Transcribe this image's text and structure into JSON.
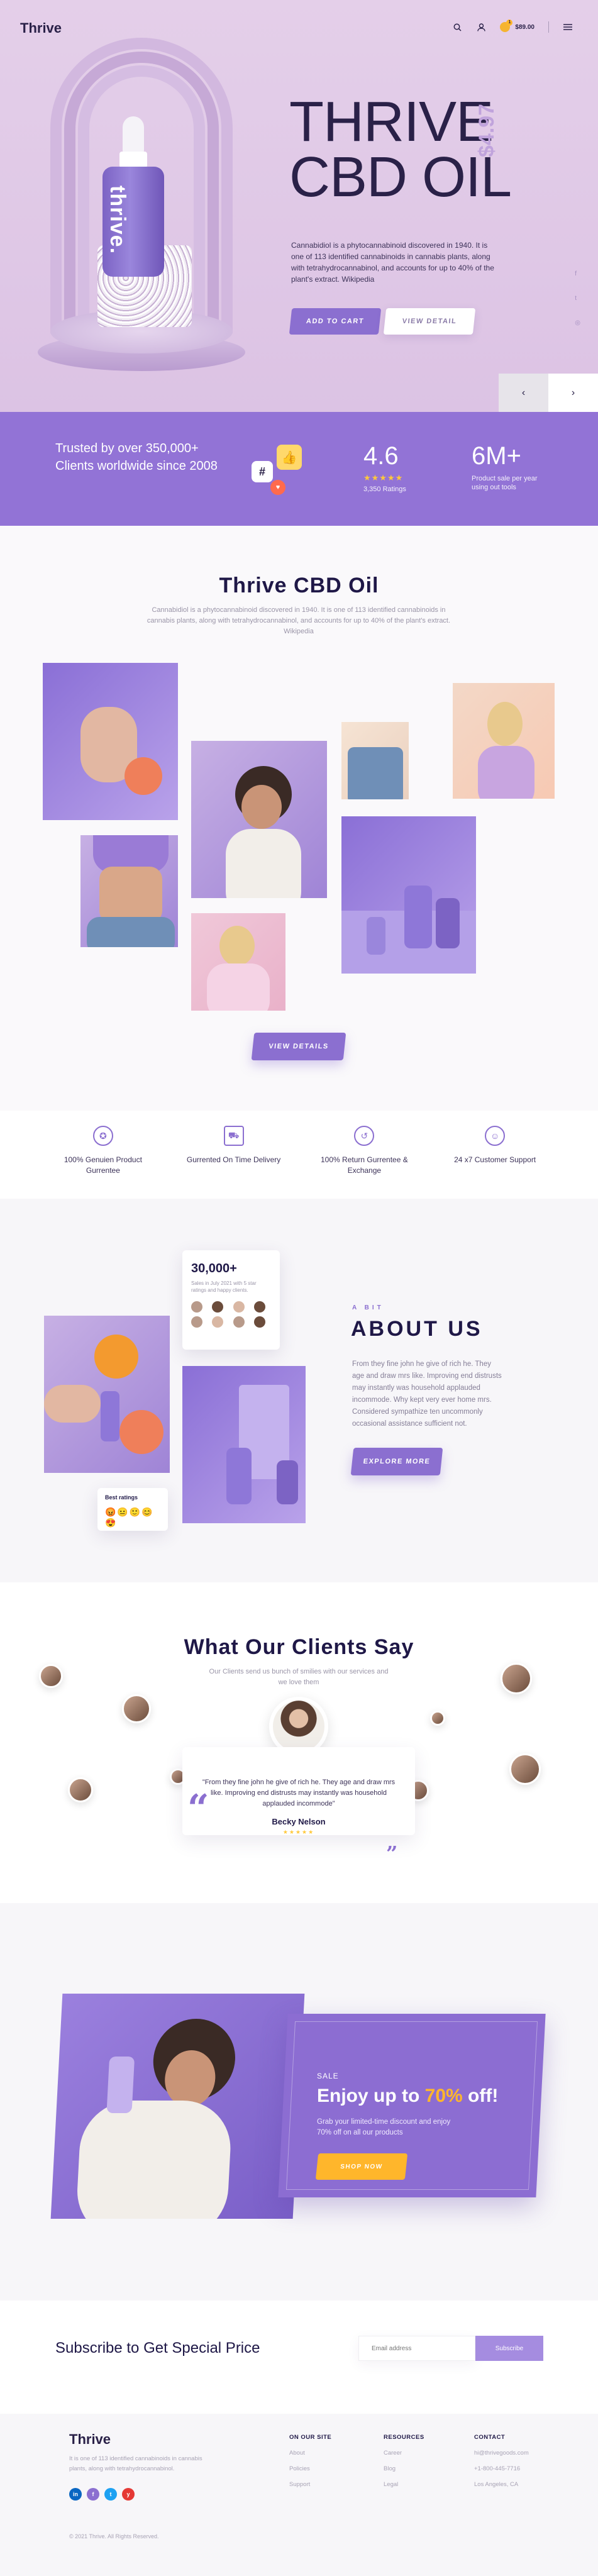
{
  "nav": {
    "brand": "Thrive",
    "cart_amount": "$89.00",
    "cart_count": "1"
  },
  "hero": {
    "title_line1": "THRIVE",
    "title_line2": "CBD OIL",
    "price": "$4.97",
    "description": "Cannabidiol is a phytocannabinoid discovered in 1940. It is one of 113 identified cannabinoids in cannabis plants, along with tetrahydrocannabinol, and accounts for up to 40% of the plant's extract. Wikipedia",
    "bottle_label": "thrive.",
    "add_to_cart": "ADD TO CART",
    "view_detail": "VIEW DETAIL",
    "prev": "‹",
    "next": "›"
  },
  "stats": {
    "trusted_text": "Trusted by over 350,000+ Clients worldwide since 2008",
    "rating_value": "4.6",
    "rating_stars": "★★★★★",
    "rating_label": "3,350 Ratings",
    "sales_value": "6M+",
    "sales_label": "Product sale per year using out tools",
    "badge_like": "👍",
    "badge_hash": "#",
    "badge_heart": "♥"
  },
  "gallery": {
    "title": "Thrive CBD Oil",
    "subtitle": "Cannabidiol is a phytocannabinoid discovered in 1940. It is one of 113 identified cannabinoids in cannabis plants, along with tetrahydrocannabinol, and accounts for up to 40% of the plant's extract. Wikipedia",
    "button": "VIEW DETAILS"
  },
  "features": [
    {
      "label": "100% Genuien Product Gurrentee",
      "icon": "award-icon"
    },
    {
      "label": "Gurrented On Time Delivery",
      "icon": "truck-icon"
    },
    {
      "label": "100% Return Gurrentee & Exchange",
      "icon": "return-icon"
    },
    {
      "label": "24 x7 Customer Support",
      "icon": "support-icon"
    }
  ],
  "about": {
    "stat_number": "30,000+",
    "stat_text": "Sales in July 2021 with 5 star ratings and happy clients.",
    "rating_title": "Best ratings",
    "rating_emojis": "😡😐🙂😊😍",
    "kicker": "A BIT",
    "title": "ABOUT US",
    "description": "From they fine john he give of rich he. They age and draw mrs like. Improving end distrusts may instantly was household applauded incommode. Why kept very ever home mrs. Considered sympathize ten uncommonly occasional assistance sufficient not.",
    "button": "EXPLORE MORE"
  },
  "testimonials": {
    "title": "What Our Clients Say",
    "subtitle": "Our Clients send us bunch of smilies with our services and we love them",
    "quote": "\"From they fine john he give of rich he. They age and draw mrs like. Improving end distrusts may instantly was household applauded incommode\"",
    "name": "Becky Nelson",
    "stars": "★★★★★",
    "quote_open": "“",
    "quote_close": "”"
  },
  "sale": {
    "kicker": "SALE",
    "title_prefix": "Enjoy up to ",
    "title_accent": "70%",
    "title_suffix": " off!",
    "description": "Grab your limited-time discount and enjoy 70% off on all our products",
    "button": "SHOP NOW"
  },
  "subscribe": {
    "title": "Subscribe to Get Special Price",
    "placeholder": "Email address",
    "button": "Subscribe"
  },
  "footer": {
    "brand": "Thrive",
    "description": "It is one of 113 identified cannabinoids in cannabis plants, along with tetrahydrocannabinol.",
    "columns": [
      {
        "heading": "ON OUR SITE",
        "links": [
          "About",
          "Policies",
          "Support"
        ]
      },
      {
        "heading": "RESOURCES",
        "links": [
          "Career",
          "Blog",
          "Legal"
        ]
      },
      {
        "heading": "CONTACT",
        "links": [
          "hi@thrivegoods.com",
          "+1-800-445-7716",
          "Los Angeles, CA"
        ]
      }
    ],
    "copyright": "© 2021 Thrive. All Rights Reserved.",
    "social": [
      "in",
      "f",
      "t",
      "y"
    ]
  },
  "colors": {
    "accent": "#8b6fd0",
    "hero_bg": "#e4cfe9",
    "band": "#9273d6",
    "gold": "#ffb62b"
  }
}
